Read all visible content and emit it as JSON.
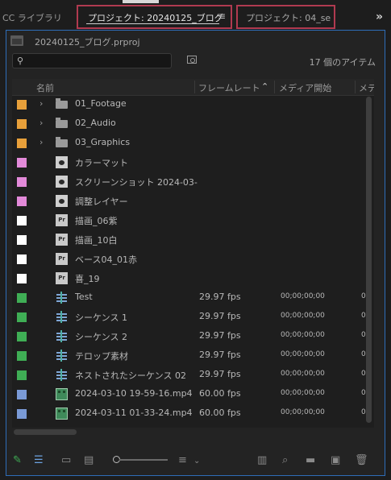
{
  "tabs": {
    "library": "CC ライブラリ",
    "active": "プロジェクト: 20240125_ブログ",
    "second": "プロジェクト:  04_se",
    "menu_glyph": "≡",
    "overflow_glyph": "»"
  },
  "project": {
    "filename": "20240125_ブログ.prproj",
    "item_count": "17 個のアイテム"
  },
  "columns": {
    "name": "名前",
    "frame_rate": "フレームレート",
    "media_start": "メディア開始",
    "media_end": "メデ"
  },
  "colors": {
    "orange": "#e8a03a",
    "pink": "#e38ad9",
    "white": "#ffffff",
    "green": "#3fae55",
    "blue": "#7a9ad6"
  },
  "items": [
    {
      "label": "orange",
      "type": "folder-icon",
      "expandable": true,
      "name": "01_Footage",
      "fps": "",
      "start": "",
      "end": ""
    },
    {
      "label": "orange",
      "type": "folder-icon",
      "expandable": true,
      "name": "02_Audio",
      "fps": "",
      "start": "",
      "end": ""
    },
    {
      "label": "orange",
      "type": "folder-icon",
      "expandable": true,
      "name": "03_Graphics",
      "fps": "",
      "start": "",
      "end": ""
    },
    {
      "label": "pink",
      "type": "synthetic-clip-icon",
      "expandable": false,
      "name": "カラーマット",
      "fps": "",
      "start": "",
      "end": ""
    },
    {
      "label": "pink",
      "type": "synthetic-clip-icon",
      "expandable": false,
      "name": "スクリーンショット 2024-03-",
      "fps": "",
      "start": "",
      "end": ""
    },
    {
      "label": "pink",
      "type": "synthetic-clip-icon",
      "expandable": false,
      "name": "調整レイヤー",
      "fps": "",
      "start": "",
      "end": ""
    },
    {
      "label": "white",
      "type": "premiere-graphic-icon",
      "expandable": false,
      "name": "描画_06紫",
      "fps": "",
      "start": "",
      "end": ""
    },
    {
      "label": "white",
      "type": "premiere-graphic-icon",
      "expandable": false,
      "name": "描画_10白",
      "fps": "",
      "start": "",
      "end": ""
    },
    {
      "label": "white",
      "type": "premiere-graphic-icon",
      "expandable": false,
      "name": "ベース04_01赤",
      "fps": "",
      "start": "",
      "end": ""
    },
    {
      "label": "white",
      "type": "premiere-graphic-icon",
      "expandable": false,
      "name": "喜_19",
      "fps": "",
      "start": "",
      "end": ""
    },
    {
      "label": "green",
      "type": "sequence-icon",
      "expandable": false,
      "name": "Test",
      "fps": "29.97 fps",
      "start": "00;00;00;00",
      "end": "0"
    },
    {
      "label": "green",
      "type": "sequence-icon",
      "expandable": false,
      "name": "シーケンス 1",
      "fps": "29.97 fps",
      "start": "00;00;00;00",
      "end": "0"
    },
    {
      "label": "green",
      "type": "sequence-icon",
      "expandable": false,
      "name": "シーケンス 2",
      "fps": "29.97 fps",
      "start": "00;00;00;00",
      "end": "0"
    },
    {
      "label": "green",
      "type": "sequence-icon",
      "expandable": false,
      "name": "テロップ素材",
      "fps": "29.97 fps",
      "start": "00;00;00;00",
      "end": "0"
    },
    {
      "label": "green",
      "type": "sequence-icon",
      "expandable": false,
      "name": "ネストされたシーケンス 02",
      "fps": "29.97 fps",
      "start": "00;00;00;00",
      "end": "0"
    },
    {
      "label": "blue",
      "type": "video-clip-icon",
      "expandable": false,
      "name": "2024-03-10 19-59-16.mp4",
      "fps": "60.00 fps",
      "start": "00;00;00;00",
      "end": "0"
    },
    {
      "label": "blue",
      "type": "video-clip-icon",
      "expandable": false,
      "name": "2024-03-11 01-33-24.mp4",
      "fps": "60.00 fps",
      "start": "00;00;00;00",
      "end": "0"
    }
  ],
  "bottom": {
    "pencil": "✎",
    "list_view": "☰",
    "icon_view": "▭",
    "freeform": "▤",
    "sort": "≡",
    "automate": "▥",
    "find": "⌕",
    "new_bin": "▬",
    "new_item": "▣",
    "delete": "🗑"
  }
}
